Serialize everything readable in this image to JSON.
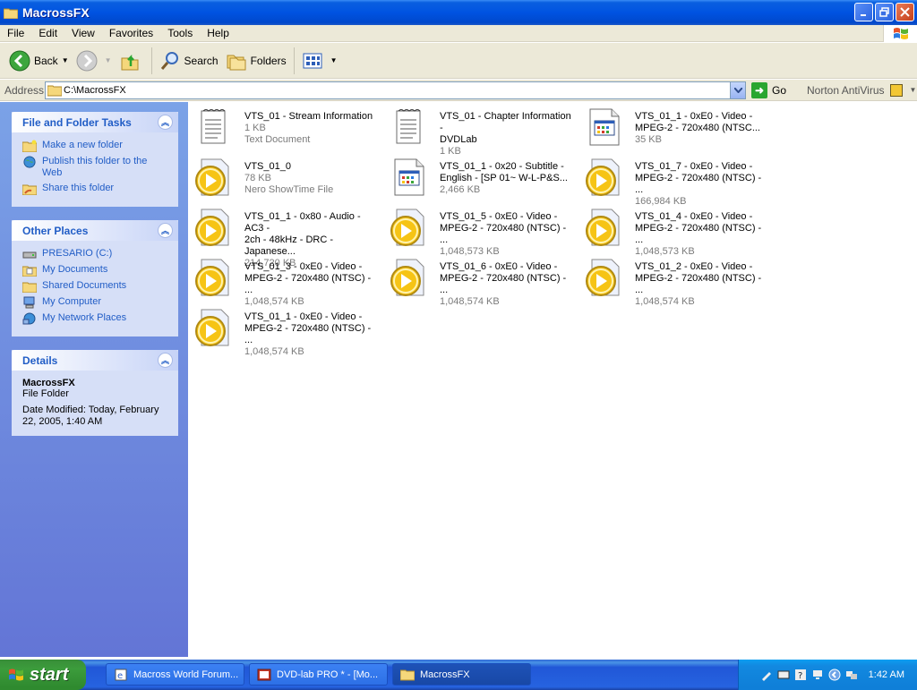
{
  "window": {
    "title": "MacrossFX"
  },
  "menu": {
    "items": [
      "File",
      "Edit",
      "View",
      "Favorites",
      "Tools",
      "Help"
    ]
  },
  "toolbar": {
    "back_label": "Back",
    "search_label": "Search",
    "folders_label": "Folders"
  },
  "address": {
    "label": "Address",
    "value": "C:\\MacrossFX",
    "go_label": "Go",
    "norton_label": "Norton AntiVirus"
  },
  "sidebar": {
    "tasks": {
      "title": "File and Folder Tasks",
      "items": [
        "Make a new folder",
        "Publish this folder to the Web",
        "Share this folder"
      ]
    },
    "places": {
      "title": "Other Places",
      "items": [
        "PRESARIO (C:)",
        "My Documents",
        "Shared Documents",
        "My Computer",
        "My Network Places"
      ]
    },
    "details": {
      "title": "Details",
      "name": "MacrossFX",
      "type": "File Folder",
      "modified": "Date Modified: Today, February 22, 2005, 1:40 AM"
    }
  },
  "files": [
    {
      "line1": "VTS_01 - Stream Information",
      "line2": "1 KB",
      "line3": "Text Document",
      "icon": "text-document-icon"
    },
    {
      "line1": "VTS_01 - Chapter Information -",
      "line2": "DVDLab",
      "line3": "1 KB",
      "icon": "text-document-icon"
    },
    {
      "line1": "VTS_01_1 - 0xE0 - Video -",
      "line2": "MPEG-2 - 720x480 (NTSC...",
      "line3": "35 KB",
      "icon": "application-file-icon"
    },
    {
      "line1": "VTS_01_0",
      "line2": "78 KB",
      "line3": "Nero ShowTime File",
      "icon": "media-file-icon"
    },
    {
      "line1": "VTS_01_1 - 0x20 - Subtitle -",
      "line2": "English - [SP 01~ W-L-P&S...",
      "line3": "2,466 KB",
      "icon": "application-file-icon"
    },
    {
      "line1": "VTS_01_7 - 0xE0 - Video -",
      "line2": "MPEG-2 - 720x480 (NTSC) - ...",
      "line3": "166,984 KB",
      "icon": "media-file-icon"
    },
    {
      "line1": "VTS_01_1 - 0x80 - Audio - AC3 -",
      "line2": "2ch - 48kHz - DRC - Japanese...",
      "line3": "214,720 KB",
      "icon": "media-file-icon"
    },
    {
      "line1": "VTS_01_5 - 0xE0 - Video -",
      "line2": "MPEG-2 - 720x480 (NTSC) - ...",
      "line3": "1,048,573 KB",
      "icon": "media-file-icon"
    },
    {
      "line1": "VTS_01_4 - 0xE0 - Video -",
      "line2": "MPEG-2 - 720x480 (NTSC) - ...",
      "line3": "1,048,573 KB",
      "icon": "media-file-icon"
    },
    {
      "line1": "VTS_01_3 - 0xE0 - Video -",
      "line2": "MPEG-2 - 720x480 (NTSC) - ...",
      "line3": "1,048,574 KB",
      "icon": "media-file-icon"
    },
    {
      "line1": "VTS_01_6 - 0xE0 - Video -",
      "line2": "MPEG-2 - 720x480 (NTSC) - ...",
      "line3": "1,048,574 KB",
      "icon": "media-file-icon"
    },
    {
      "line1": "VTS_01_2 - 0xE0 - Video -",
      "line2": "MPEG-2 - 720x480 (NTSC) - ...",
      "line3": "1,048,574 KB",
      "icon": "media-file-icon"
    },
    {
      "line1": "VTS_01_1 - 0xE0 - Video -",
      "line2": "MPEG-2 - 720x480 (NTSC) - ...",
      "line3": "1,048,574 KB",
      "icon": "media-file-icon"
    }
  ],
  "taskbar": {
    "start_label": "start",
    "tasks": [
      "Macross World Forum...",
      "DVD-lab PRO * - [Mo...",
      "MacrossFX"
    ],
    "clock": "1:42 AM"
  }
}
